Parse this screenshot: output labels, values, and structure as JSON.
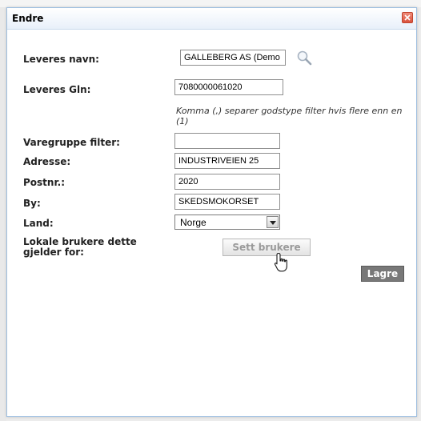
{
  "dialog": {
    "title": "Endre",
    "close_icon": "close-icon"
  },
  "form": {
    "leveres_navn": {
      "label": "Leveres navn:",
      "value": "GALLEBERG AS (Demo"
    },
    "leveres_gln": {
      "label": "Leveres Gln:",
      "value": "7080000061020"
    },
    "hint": "Komma (,) separer godstype filter hvis flere enn en (1)",
    "varegruppe": {
      "label": "Varegruppe filter:",
      "value": ""
    },
    "adresse": {
      "label": "Adresse:",
      "value": "INDUSTRIVEIEN 25"
    },
    "postnr": {
      "label": "Postnr.:",
      "value": "2020"
    },
    "by": {
      "label": "By:",
      "value": "SKEDSMOKORSET"
    },
    "land": {
      "label": "Land:",
      "selected": "Norge"
    },
    "lokale": {
      "label": "Lokale brukere dette gjelder for:"
    }
  },
  "buttons": {
    "sett_brukere": "Sett brukere",
    "lagre": "Lagre"
  },
  "colors": {
    "close": "#d9523c",
    "save_button": "#787878",
    "title_gradient": "#e8f0fa"
  }
}
